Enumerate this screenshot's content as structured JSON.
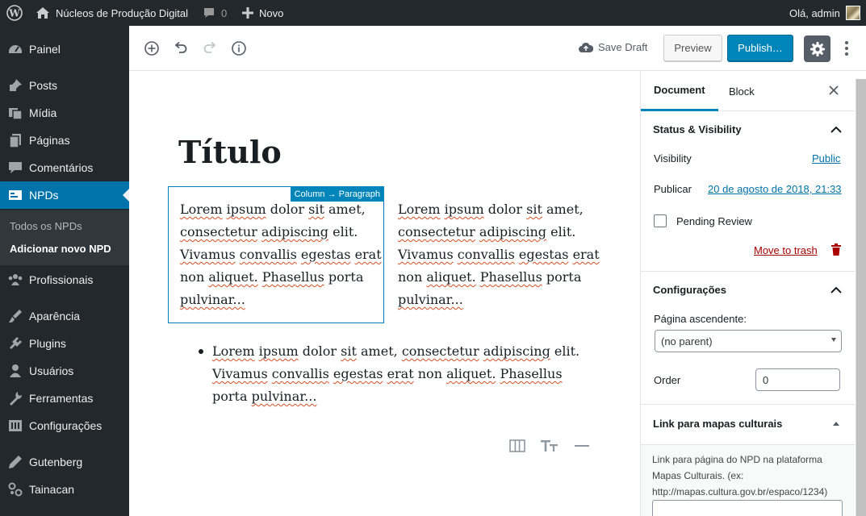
{
  "admin_bar": {
    "site_name": "Núcleos de Produção Digital",
    "comments_count": "0",
    "new_label": "Novo",
    "greeting": "Olá, admin"
  },
  "menu": {
    "items": [
      {
        "label": "Painel",
        "icon": "dashboard-icon"
      },
      {
        "label": "Posts",
        "icon": "pin-icon"
      },
      {
        "label": "Mídia",
        "icon": "media-icon"
      },
      {
        "label": "Páginas",
        "icon": "pages-icon"
      },
      {
        "label": "Comentários",
        "icon": "comment-icon"
      },
      {
        "label": "NPDs",
        "icon": "npd-icon"
      },
      {
        "label": "Profissionais",
        "icon": "groups-icon"
      },
      {
        "label": "Aparência",
        "icon": "brush-icon"
      },
      {
        "label": "Plugins",
        "icon": "plugin-icon"
      },
      {
        "label": "Usuários",
        "icon": "user-icon"
      },
      {
        "label": "Ferramentas",
        "icon": "wrench-icon"
      },
      {
        "label": "Configurações",
        "icon": "settings-icon"
      },
      {
        "label": "Gutenberg",
        "icon": "pencil-icon"
      },
      {
        "label": "Tainacan",
        "icon": "tainacan-icon"
      }
    ],
    "submenu": [
      "Todos os NPDs",
      "Adicionar novo NPD"
    ]
  },
  "header": {
    "save_draft": "Save Draft",
    "preview": "Preview",
    "publish": "Publish…"
  },
  "editor": {
    "title": "Título",
    "block_label": "Column → Paragraph",
    "paragraph_text": "Lorem ipsum dolor sit amet, consectetur adipiscing elit. Vivamus convallis egestas erat non aliquet. Phasellus porta pulvinar...",
    "list_item": "Lorem ipsum dolor sit amet, consectetur adipiscing elit. Vivamus convallis egestas erat non aliquet. Phasellus porta pulvinar..."
  },
  "sidebar": {
    "tabs": [
      "Document",
      "Block"
    ],
    "status_title": "Status & Visibility",
    "visibility_label": "Visibility",
    "visibility_value": "Public",
    "publish_label": "Publicar",
    "publish_date": "20 de agosto de 2018, 21:33",
    "pending_review": "Pending Review",
    "move_to_trash": "Move to trash",
    "config_title": "Configurações",
    "parent_label": "Página ascendente:",
    "parent_value": "(no parent)",
    "order_label": "Order",
    "order_value": "0",
    "meta_title": "Link para mapas culturais",
    "meta_description": "Link para página do NPD na plataforma Mapas Culturais. (ex: http://mapas.cultura.gov.br/espaco/1234)"
  },
  "colors": {
    "admin_dark": "#23282d",
    "accent": "#0073aa",
    "publish": "#0085ba",
    "trash": "#a00"
  }
}
